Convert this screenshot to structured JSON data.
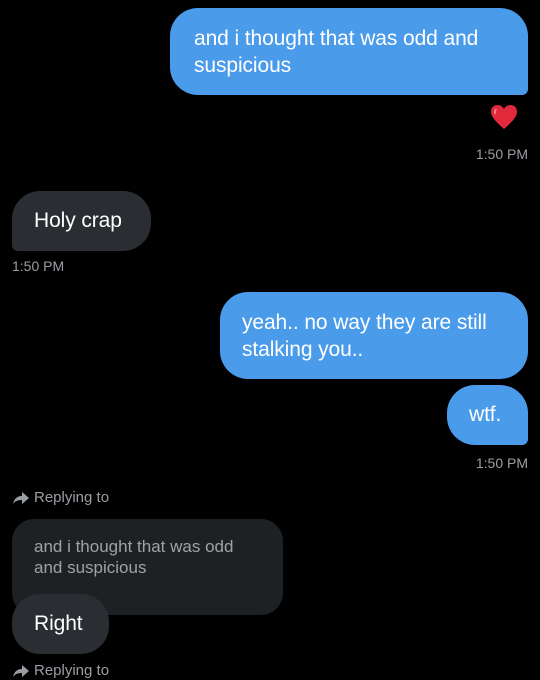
{
  "messages": {
    "sent_1": {
      "text": "and i thought that was odd and suspicious",
      "reaction": "red-heart",
      "time": "1:50 PM"
    },
    "recv_1": {
      "text": "Holy crap",
      "time": "1:50 PM"
    },
    "sent_2": {
      "text": "yeah.. no way they are still stalking you.."
    },
    "sent_3": {
      "text": "wtf.",
      "time": "1:50 PM"
    },
    "recv_2": {
      "replying_label": "Replying to",
      "quoted_text": "and i thought that was odd and suspicious",
      "text": "Right"
    },
    "recv_3": {
      "replying_label": "Replying to"
    }
  },
  "colors": {
    "sent_bubble": "#4a9bea",
    "received_bubble": "#2a2d31",
    "quote_bubble": "#1e2124",
    "timestamp": "#9a9ea3",
    "heart": "#e0293b"
  }
}
